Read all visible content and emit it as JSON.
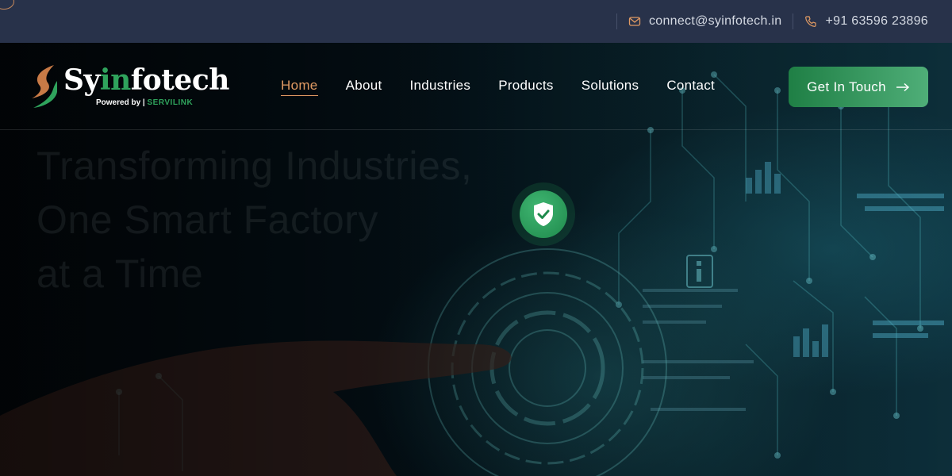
{
  "topbar": {
    "email": "connect@syinfotech.in",
    "phone": "+91 63596 23896",
    "email_icon": "mail-icon",
    "phone_icon": "phone-icon"
  },
  "logo": {
    "word_prefix": "Sy",
    "word_accent": "in",
    "word_suffix": "fotech",
    "powered_by": "Powered by |",
    "brand": "SERVILINK"
  },
  "nav": {
    "items": [
      {
        "label": "Home",
        "active": true
      },
      {
        "label": "About"
      },
      {
        "label": "Industries"
      },
      {
        "label": "Products"
      },
      {
        "label": "Solutions"
      },
      {
        "label": "Contact"
      }
    ]
  },
  "cta": {
    "label": "Get In Touch",
    "icon": "arrow-right-icon"
  },
  "hero": {
    "headline": [
      "Transforming Industries,",
      "One Smart Factory",
      "at a Time"
    ],
    "badge_icon": "shield-check-icon"
  },
  "colors": {
    "topbar_bg": "#28324a",
    "accent_orange": "#e09a63",
    "accent_green": "#2fa35c"
  }
}
